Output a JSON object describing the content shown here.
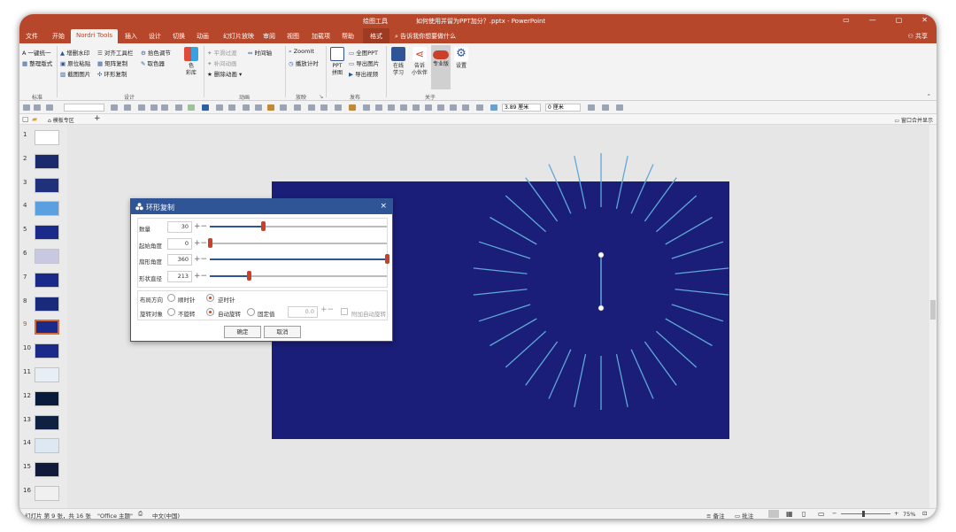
{
  "window": {
    "context_tab": "绘图工具",
    "title": "如何使用并留为PPT加分？.pptx - PowerPoint",
    "controls": [
      "▭",
      "—",
      "▢",
      "✕"
    ]
  },
  "tabs": [
    "文件",
    "开始",
    "Nordri Tools",
    "插入",
    "设计",
    "切换",
    "动画",
    "幻灯片放映",
    "审阅",
    "视图",
    "加载项",
    "帮助",
    "格式"
  ],
  "search_placeholder": "告诉我你想要做什么",
  "share_label": "共享",
  "ribbon": {
    "standard": [
      "A 一键统一",
      "整理版式"
    ],
    "design_col1": [
      "增删水印",
      "原位粘贴",
      "截图图片"
    ],
    "design_col2": [
      "对齐工具栏",
      "矩阵复制",
      "环形复制"
    ],
    "design_col3": [
      "拾色调节",
      "取色器"
    ],
    "color_lib": "色\n彩库",
    "anim": [
      "平滑过渡",
      "补间动画",
      "删除动画 ▾"
    ],
    "anim_right": [
      "时间轴"
    ],
    "play": [
      "ZoomIt",
      "播放计时"
    ],
    "publish_big": "PPT\n拼图",
    "publish": [
      "全图PPT",
      "导出图片",
      "导出视频"
    ],
    "about": [
      "在线\n学习",
      "告诉\n小伙伴",
      "专业版",
      "设置"
    ],
    "groups": [
      "标准",
      "设计",
      "动画",
      "放映",
      "发布",
      "关于"
    ]
  },
  "format_toolbar": {
    "size1": "3.89 厘米",
    "size2": "0 厘米"
  },
  "doc_tab": "模板专区",
  "doc_right": "窗口合并显示",
  "slides": [
    {
      "n": "1",
      "c": "#ffffff"
    },
    {
      "n": "2",
      "c": "#1a2a6c"
    },
    {
      "n": "3",
      "c": "#20307a"
    },
    {
      "n": "4",
      "c": "#5aa0e0"
    },
    {
      "n": "5",
      "c": "#1a2a8a"
    },
    {
      "n": "6",
      "c": "#c8c8e0"
    },
    {
      "n": "7",
      "c": "#1a2a8a"
    },
    {
      "n": "8",
      "c": "#1a2a7a"
    },
    {
      "n": "9",
      "c": "#1a2a8a"
    },
    {
      "n": "10",
      "c": "#1a2a8a"
    },
    {
      "n": "11",
      "c": "#e8eef6"
    },
    {
      "n": "12",
      "c": "#0a1a3a"
    },
    {
      "n": "13",
      "c": "#102040"
    },
    {
      "n": "14",
      "c": "#dde8f2"
    },
    {
      "n": "15",
      "c": "#101a3a"
    },
    {
      "n": "16",
      "c": "#f0f0f0"
    }
  ],
  "selected_slide": "9",
  "status": {
    "slide_info": "幻灯片 第 9 张，共 16 张",
    "theme": "\"Office 主题\"",
    "lang": "中文(中国)",
    "notes": "备注",
    "comments": "批注",
    "zoom": "75%"
  },
  "dialog": {
    "title": "环形复制",
    "params": [
      {
        "label": "数量",
        "value": "30",
        "fraction": 0.3
      },
      {
        "label": "起始角度",
        "value": "0",
        "fraction": 0.0
      },
      {
        "label": "扇形角度",
        "value": "360",
        "fraction": 1.0
      },
      {
        "label": "形状直径",
        "value": "213",
        "fraction": 0.22
      }
    ],
    "layout_dir_label": "布局方向",
    "dir_options": [
      "顺时针",
      "逆时针"
    ],
    "dir_selected": "逆时针",
    "rotate_label": "旋转对象",
    "rotate_options": [
      "不旋转",
      "自动旋转",
      "固定值"
    ],
    "rotate_selected": "自动旋转",
    "fixed_value": "0.0",
    "extra_option": "附加自动旋转",
    "ok": "确定",
    "cancel": "取消"
  },
  "colors": {
    "accent": "#b7472a",
    "dialog_header": "#2f5597",
    "slide_bg": "#1a1e78",
    "ray": "#5fa8d8",
    "knob": "#c9412a"
  }
}
